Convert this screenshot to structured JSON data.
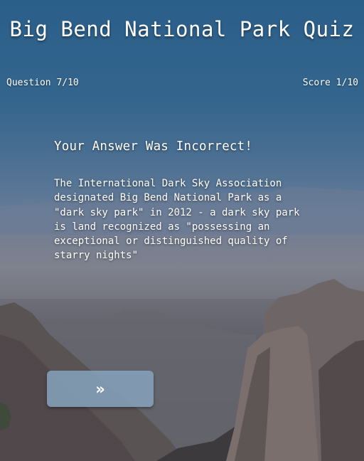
{
  "app": {
    "title": "Big Bend National Park Quiz"
  },
  "status": {
    "question": "Question 7/10",
    "score": "Score 1/10"
  },
  "feedback": {
    "heading": "Your Answer Was Incorrect!",
    "body": "The International Dark Sky Association designated Big Bend National Park as a \"dark sky park\" in 2012 - a dark sky park is land recognized as \"possessing an exceptional or distinguished quality of starry nights\""
  },
  "next_button": {
    "label": "»"
  },
  "background": {
    "subject": "desert-mountain-landscape",
    "sky_color": "#2a5f8a",
    "button_color": "#84a0ba"
  }
}
